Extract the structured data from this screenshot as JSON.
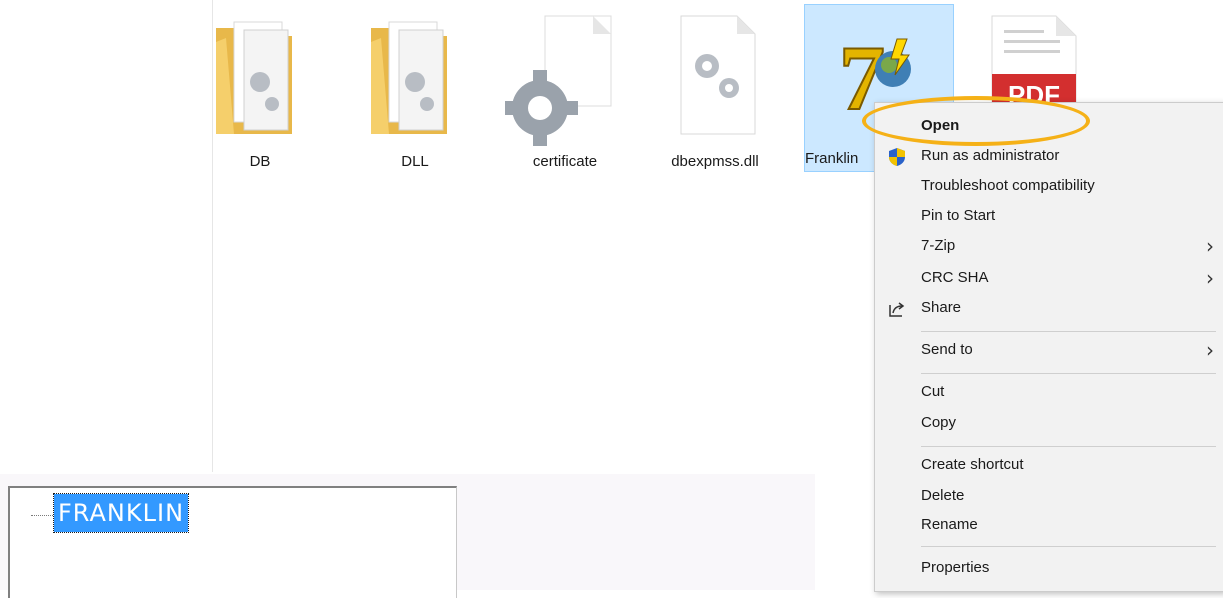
{
  "files": [
    {
      "name": "DB",
      "icon": "folder-settings-icon"
    },
    {
      "name": "DLL",
      "icon": "folder-settings-icon"
    },
    {
      "name": "certificate",
      "icon": "gear-icon"
    },
    {
      "name": "dbexpmss.dll",
      "icon": "dll-file-icon"
    },
    {
      "name": "Franklin",
      "icon": "app-7-icon",
      "selected": true
    },
    {
      "name": "",
      "icon": "pdf-file-icon",
      "badge": "PDF"
    }
  ],
  "context_menu": {
    "items": [
      {
        "label": "Open",
        "bold": true
      },
      {
        "label": "Run as administrator",
        "icon": "uac-shield-icon"
      },
      {
        "label": "Troubleshoot compatibility"
      },
      {
        "label": "Pin to Start"
      },
      {
        "label": "7-Zip",
        "submenu": true
      },
      {
        "label": "CRC SHA",
        "submenu": true
      },
      {
        "label": "Share",
        "icon": "share-icon"
      },
      {
        "label": "Send to",
        "submenu": true
      },
      {
        "label": "Cut"
      },
      {
        "label": "Copy"
      },
      {
        "label": "Create shortcut"
      },
      {
        "label": "Delete"
      },
      {
        "label": "Rename"
      },
      {
        "label": "Properties"
      }
    ],
    "highlight_color": "#f5b117",
    "submenu_glyph": "›"
  },
  "tree": {
    "node_label": "FRANKLIN",
    "selected_color": "#3399ff"
  }
}
